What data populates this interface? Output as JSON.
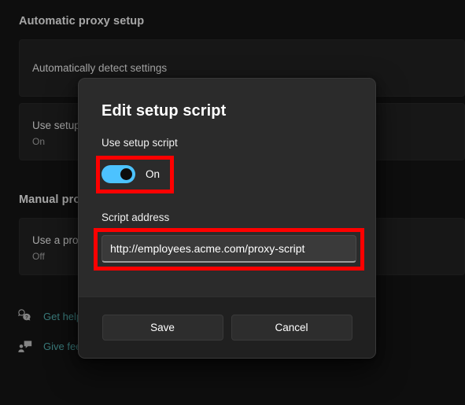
{
  "page": {
    "sections": [
      {
        "heading": "Automatic proxy setup"
      },
      {
        "heading": "Manual proxy setup"
      }
    ],
    "cards": {
      "auto_detect": {
        "label": "Automatically detect settings"
      },
      "setup_script": {
        "label": "Use setup script",
        "state": "On"
      },
      "use_proxy": {
        "label": "Use a proxy server",
        "state": "Off"
      }
    },
    "footer_links": [
      {
        "label": "Get help",
        "icon": "help-question-bubble-icon"
      },
      {
        "label": "Give feedback",
        "icon": "feedback-person-bubble-icon"
      }
    ],
    "link_color": "#4fa8a8"
  },
  "dialog": {
    "title": "Edit setup script",
    "use_setup_script": {
      "label": "Use setup script",
      "toggle_state": "On",
      "toggle_on": true,
      "accent_color": "#4cc2ff"
    },
    "script_address": {
      "label": "Script address",
      "value": "http://employees.acme.com/proxy-script",
      "placeholder": "Script address"
    },
    "buttons": {
      "save": "Save",
      "cancel": "Cancel"
    },
    "highlight_color": "#fe0000"
  }
}
